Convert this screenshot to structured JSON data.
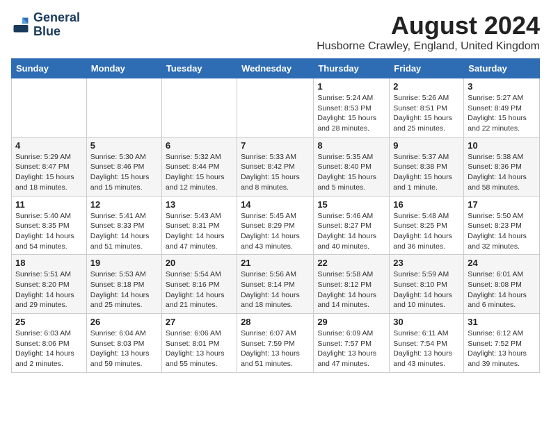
{
  "logo": {
    "line1": "General",
    "line2": "Blue"
  },
  "title": "August 2024",
  "location": "Husborne Crawley, England, United Kingdom",
  "days_of_week": [
    "Sunday",
    "Monday",
    "Tuesday",
    "Wednesday",
    "Thursday",
    "Friday",
    "Saturday"
  ],
  "weeks": [
    [
      {
        "day": "",
        "info": ""
      },
      {
        "day": "",
        "info": ""
      },
      {
        "day": "",
        "info": ""
      },
      {
        "day": "",
        "info": ""
      },
      {
        "day": "1",
        "info": "Sunrise: 5:24 AM\nSunset: 8:53 PM\nDaylight: 15 hours\nand 28 minutes."
      },
      {
        "day": "2",
        "info": "Sunrise: 5:26 AM\nSunset: 8:51 PM\nDaylight: 15 hours\nand 25 minutes."
      },
      {
        "day": "3",
        "info": "Sunrise: 5:27 AM\nSunset: 8:49 PM\nDaylight: 15 hours\nand 22 minutes."
      }
    ],
    [
      {
        "day": "4",
        "info": "Sunrise: 5:29 AM\nSunset: 8:47 PM\nDaylight: 15 hours\nand 18 minutes."
      },
      {
        "day": "5",
        "info": "Sunrise: 5:30 AM\nSunset: 8:46 PM\nDaylight: 15 hours\nand 15 minutes."
      },
      {
        "day": "6",
        "info": "Sunrise: 5:32 AM\nSunset: 8:44 PM\nDaylight: 15 hours\nand 12 minutes."
      },
      {
        "day": "7",
        "info": "Sunrise: 5:33 AM\nSunset: 8:42 PM\nDaylight: 15 hours\nand 8 minutes."
      },
      {
        "day": "8",
        "info": "Sunrise: 5:35 AM\nSunset: 8:40 PM\nDaylight: 15 hours\nand 5 minutes."
      },
      {
        "day": "9",
        "info": "Sunrise: 5:37 AM\nSunset: 8:38 PM\nDaylight: 15 hours\nand 1 minute."
      },
      {
        "day": "10",
        "info": "Sunrise: 5:38 AM\nSunset: 8:36 PM\nDaylight: 14 hours\nand 58 minutes."
      }
    ],
    [
      {
        "day": "11",
        "info": "Sunrise: 5:40 AM\nSunset: 8:35 PM\nDaylight: 14 hours\nand 54 minutes."
      },
      {
        "day": "12",
        "info": "Sunrise: 5:41 AM\nSunset: 8:33 PM\nDaylight: 14 hours\nand 51 minutes."
      },
      {
        "day": "13",
        "info": "Sunrise: 5:43 AM\nSunset: 8:31 PM\nDaylight: 14 hours\nand 47 minutes."
      },
      {
        "day": "14",
        "info": "Sunrise: 5:45 AM\nSunset: 8:29 PM\nDaylight: 14 hours\nand 43 minutes."
      },
      {
        "day": "15",
        "info": "Sunrise: 5:46 AM\nSunset: 8:27 PM\nDaylight: 14 hours\nand 40 minutes."
      },
      {
        "day": "16",
        "info": "Sunrise: 5:48 AM\nSunset: 8:25 PM\nDaylight: 14 hours\nand 36 minutes."
      },
      {
        "day": "17",
        "info": "Sunrise: 5:50 AM\nSunset: 8:23 PM\nDaylight: 14 hours\nand 32 minutes."
      }
    ],
    [
      {
        "day": "18",
        "info": "Sunrise: 5:51 AM\nSunset: 8:20 PM\nDaylight: 14 hours\nand 29 minutes."
      },
      {
        "day": "19",
        "info": "Sunrise: 5:53 AM\nSunset: 8:18 PM\nDaylight: 14 hours\nand 25 minutes."
      },
      {
        "day": "20",
        "info": "Sunrise: 5:54 AM\nSunset: 8:16 PM\nDaylight: 14 hours\nand 21 minutes."
      },
      {
        "day": "21",
        "info": "Sunrise: 5:56 AM\nSunset: 8:14 PM\nDaylight: 14 hours\nand 18 minutes."
      },
      {
        "day": "22",
        "info": "Sunrise: 5:58 AM\nSunset: 8:12 PM\nDaylight: 14 hours\nand 14 minutes."
      },
      {
        "day": "23",
        "info": "Sunrise: 5:59 AM\nSunset: 8:10 PM\nDaylight: 14 hours\nand 10 minutes."
      },
      {
        "day": "24",
        "info": "Sunrise: 6:01 AM\nSunset: 8:08 PM\nDaylight: 14 hours\nand 6 minutes."
      }
    ],
    [
      {
        "day": "25",
        "info": "Sunrise: 6:03 AM\nSunset: 8:06 PM\nDaylight: 14 hours\nand 2 minutes."
      },
      {
        "day": "26",
        "info": "Sunrise: 6:04 AM\nSunset: 8:03 PM\nDaylight: 13 hours\nand 59 minutes."
      },
      {
        "day": "27",
        "info": "Sunrise: 6:06 AM\nSunset: 8:01 PM\nDaylight: 13 hours\nand 55 minutes."
      },
      {
        "day": "28",
        "info": "Sunrise: 6:07 AM\nSunset: 7:59 PM\nDaylight: 13 hours\nand 51 minutes."
      },
      {
        "day": "29",
        "info": "Sunrise: 6:09 AM\nSunset: 7:57 PM\nDaylight: 13 hours\nand 47 minutes."
      },
      {
        "day": "30",
        "info": "Sunrise: 6:11 AM\nSunset: 7:54 PM\nDaylight: 13 hours\nand 43 minutes."
      },
      {
        "day": "31",
        "info": "Sunrise: 6:12 AM\nSunset: 7:52 PM\nDaylight: 13 hours\nand 39 minutes."
      }
    ]
  ]
}
